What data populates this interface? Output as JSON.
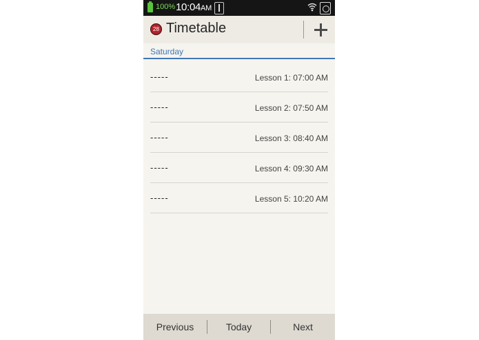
{
  "status_bar": {
    "battery_percent": "100%",
    "time": "10:04",
    "time_suffix": "AM"
  },
  "action_bar": {
    "app_icon_text": "28",
    "title": "Timetable"
  },
  "section": {
    "label": "Saturday"
  },
  "lessons": [
    {
      "subject": "-----",
      "time": "Lesson 1: 07:00 AM"
    },
    {
      "subject": "-----",
      "time": "Lesson 2: 07:50 AM"
    },
    {
      "subject": "-----",
      "time": "Lesson 3: 08:40 AM"
    },
    {
      "subject": "-----",
      "time": "Lesson 4: 09:30 AM"
    },
    {
      "subject": "-----",
      "time": "Lesson 5: 10:20 AM"
    }
  ],
  "bottom_bar": {
    "previous": "Previous",
    "today": "Today",
    "next": "Next"
  },
  "icons": {
    "battery": "battery-icon",
    "usb": "usb-icon",
    "wifi": "wifi-icon",
    "sync": "sync-icon",
    "add": "plus-icon"
  },
  "colors": {
    "accent": "#3d77b4",
    "battery": "#58c43a",
    "app_icon": "#b1232b"
  }
}
